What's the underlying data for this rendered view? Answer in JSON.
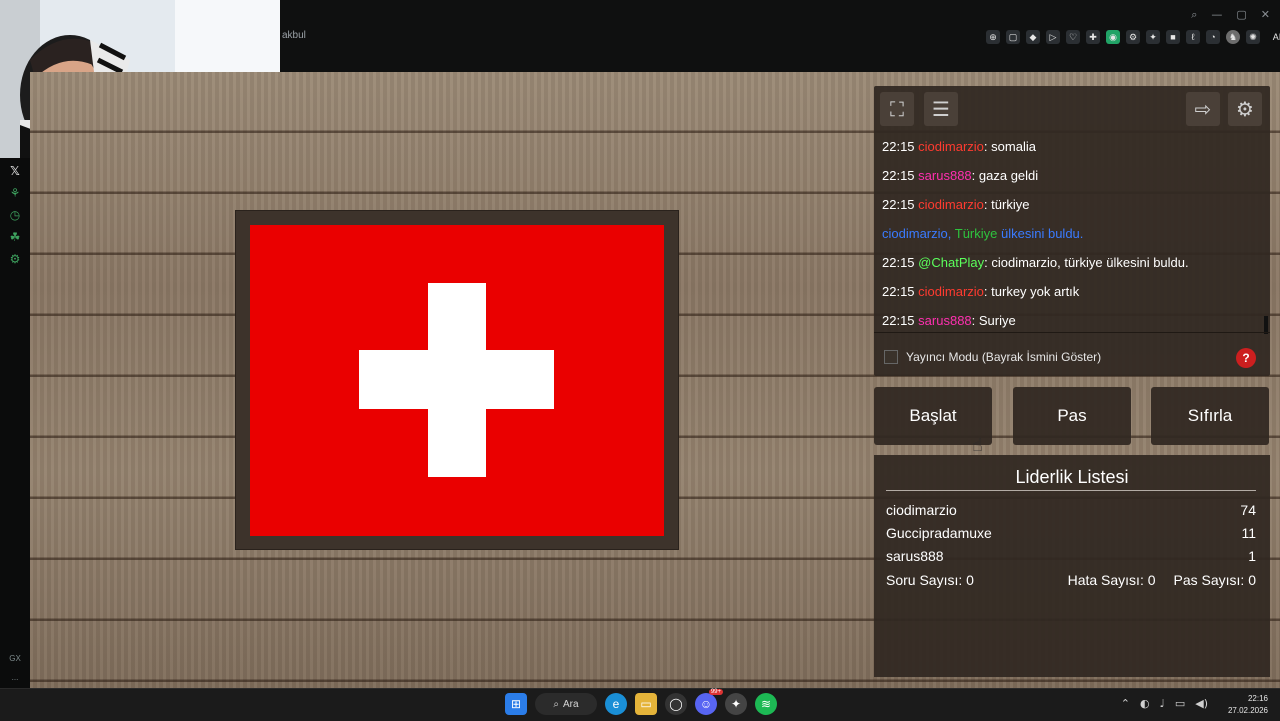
{
  "browser": {
    "tab_title_fragment": "akbul",
    "window_controls": [
      "⌕",
      "—",
      "▢",
      "✕"
    ],
    "extensions": [
      "⊕",
      "▢",
      "◆",
      "▷",
      "♡",
      "✚",
      "◉",
      "⚙",
      "✦",
      "■",
      "ℓ",
      "◔",
      "♞",
      "✺",
      "AI",
      "▤"
    ]
  },
  "sidebar": {
    "icons": [
      "x-icon",
      "leaf-icon",
      "clock-icon",
      "frog-icon",
      "plug-icon"
    ],
    "bottom": [
      "GX",
      "..."
    ]
  },
  "game": {
    "panel_icons": {
      "fullscreen": "⛶",
      "list": "☰",
      "exit": "⇨",
      "settings": "⚙"
    },
    "chat": [
      {
        "time": "22:15",
        "user": "ciodimarzio",
        "color": "red",
        "sep": ": ",
        "msg": "somalia"
      },
      {
        "time": "22:15",
        "user": "sarus888",
        "color": "pink",
        "sep": ": ",
        "msg": "gaza geldi"
      },
      {
        "time": "22:15",
        "user": "ciodimarzio",
        "color": "red",
        "sep": ": ",
        "msg": "türkiye"
      },
      {
        "system": true,
        "user": "ciodimarzio,",
        "country": "Türkiye",
        "msg": "ülkesini buldu."
      },
      {
        "time": "22:15",
        "user": "@ChatPlay",
        "color": "lime",
        "sep": ": ",
        "msg": "ciodimarzio, türkiye ülkesini buldu."
      },
      {
        "time": "22:15",
        "user": "ciodimarzio",
        "color": "red",
        "sep": ": ",
        "msg": "turkey yok artık"
      },
      {
        "time": "22:15",
        "user": "sarus888",
        "color": "pink",
        "sep": ": ",
        "msg": "Suriye"
      }
    ],
    "streamer_mode_label": "Yayıncı Modu (Bayrak İsmini Göster)",
    "help_label": "?",
    "buttons": {
      "start": "Başlat",
      "pass": "Pas",
      "reset": "Sıfırla"
    },
    "leaderboard": {
      "title": "Liderlik Listesi",
      "rows": [
        {
          "name": "ciodimarzio",
          "score": "74"
        },
        {
          "name": "Guccipradamuxe",
          "score": "11"
        },
        {
          "name": "sarus888",
          "score": "1"
        }
      ],
      "stats": {
        "questions": "Soru Sayısı: 0",
        "errors": "Hata Sayısı: 0",
        "passes": "Pas Sayısı: 0"
      }
    }
  },
  "taskbar": {
    "search_label": "Ara",
    "time": "22:16",
    "date": "27.02.2026",
    "badge": "99+"
  },
  "colors": {
    "flag_red": "#ea0000",
    "panel_bg": "#30281f",
    "user_red": "#ff3b30",
    "user_pink": "#ff2fb0",
    "user_blue": "#3a7bff",
    "user_green": "#2ec23e",
    "user_lime": "#5bff5b"
  }
}
